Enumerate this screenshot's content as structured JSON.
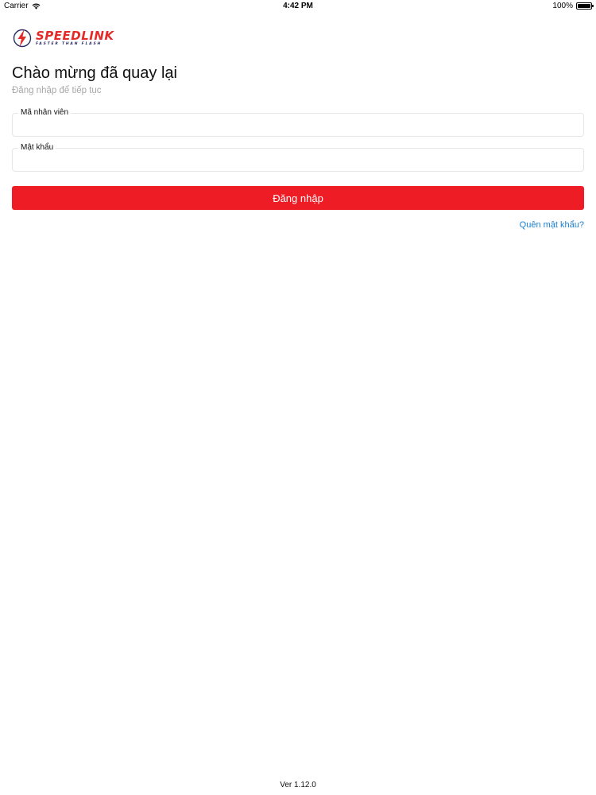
{
  "status_bar": {
    "carrier": "Carrier",
    "time": "4:42 PM",
    "battery_percent": "100%",
    "battery_level": 1.0,
    "wifi_icon": "wifi-icon"
  },
  "logo": {
    "brand": "SPEEDLINK",
    "tagline": "FASTER THAN FLASH",
    "icon": "lightning-bolt-icon"
  },
  "login": {
    "title": "Chào mừng đã quay lại",
    "subtitle": "Đăng nhập để tiếp tục",
    "employee_label": "Mã nhân viên",
    "employee_value": "",
    "password_label": "Mật khẩu",
    "password_value": "",
    "submit_label": "Đăng nhập",
    "forgot_label": "Quên mật khẩu?"
  },
  "footer": {
    "version": "Ver 1.12.0"
  },
  "colors": {
    "primary": "#ee1c24",
    "link": "#1a7fd0",
    "muted": "#a7a7a7"
  }
}
